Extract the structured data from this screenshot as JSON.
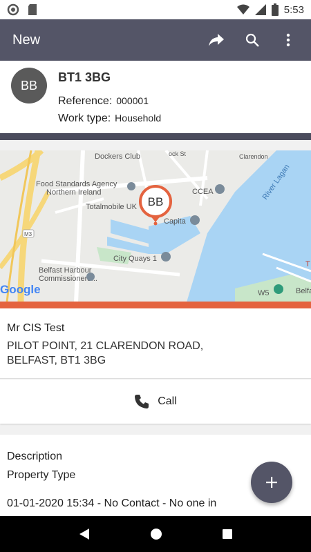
{
  "status_bar": {
    "time": "5:53"
  },
  "app_bar": {
    "title": "New",
    "icons": [
      "share-icon",
      "search-icon",
      "more-vert-icon"
    ]
  },
  "job": {
    "avatar_initials": "BB",
    "postcode": "BT1 3BG",
    "reference_label": "Reference:",
    "reference_value": "000001",
    "work_type_label": "Work type:",
    "work_type_value": "Household"
  },
  "map": {
    "marker_label": "BB",
    "labels": {
      "dockers_club": "Dockers Club",
      "food_standards_1": "Food Standards Agency",
      "food_standards_2": "Northern Ireland",
      "totalmobile": "Totalmobile UK",
      "ccea": "CCEA",
      "capita": "Capita",
      "city_quays": "City Quays 1",
      "belfast_harbour_1": "Belfast Harbour",
      "belfast_harbour_2": "Commissioners...",
      "river_lagan": "River Lagan",
      "w5": "W5",
      "belfa": "Belfa",
      "m3": "M3",
      "clarendon": "Clarendon",
      "ock_st": "ock St",
      "google": "Google",
      "t_edge": "T"
    },
    "accent_color": "#e4633f"
  },
  "address": {
    "contact_name": "Mr CIS Test",
    "line1": "PILOT POINT, 21 CLARENDON ROAD,",
    "line2": "BELFAST, BT1 3BG"
  },
  "call": {
    "label": "Call"
  },
  "details": {
    "description_label": "Description",
    "property_type_label": "Property Type",
    "log_entry": "01-01-2020 15:34 - No Contact - No one in"
  },
  "colors": {
    "app_bar": "#545567",
    "accent": "#e4633f",
    "water": "#a9d4f4",
    "park": "#c8e6c9"
  }
}
